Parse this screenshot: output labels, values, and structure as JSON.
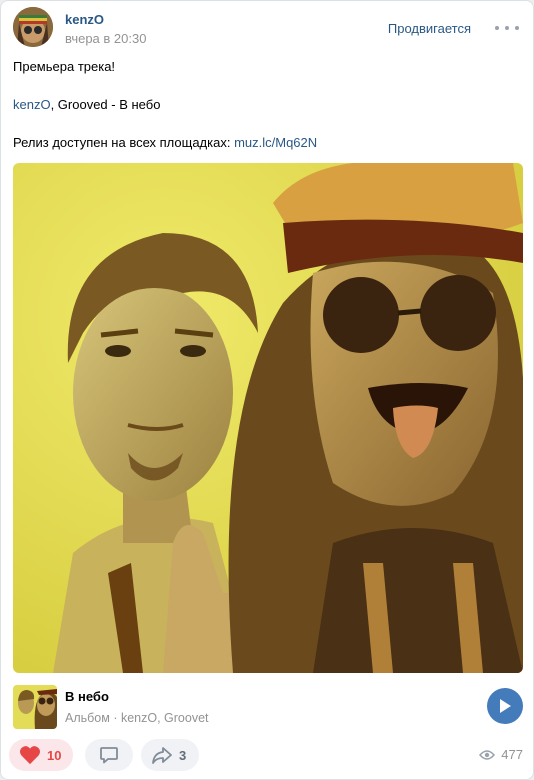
{
  "post": {
    "author": "kenzO",
    "time": "вчера в 20:30",
    "promo_label": "Продвигается",
    "text_line1": "Премьера трека!",
    "credit_artist_link": "kenzO",
    "credit_rest": ", Grooved - В небо",
    "release_prefix": "Релиз доступен на всех площадках: ",
    "release_link": "muz.lc/Mq62N"
  },
  "album": {
    "title": "В небо",
    "subtitle": "Альбом · kenzO, Groovet"
  },
  "actions": {
    "likes": "10",
    "shares": "3",
    "views": "477"
  },
  "colors": {
    "link": "#2a5885",
    "like_active": "#e64646",
    "play_button": "#447bba",
    "artwork_background": "#e3dc56"
  },
  "icons": [
    "avatar",
    "more-icon",
    "heart-icon",
    "comment-icon",
    "share-icon",
    "eye-icon",
    "play-icon"
  ]
}
